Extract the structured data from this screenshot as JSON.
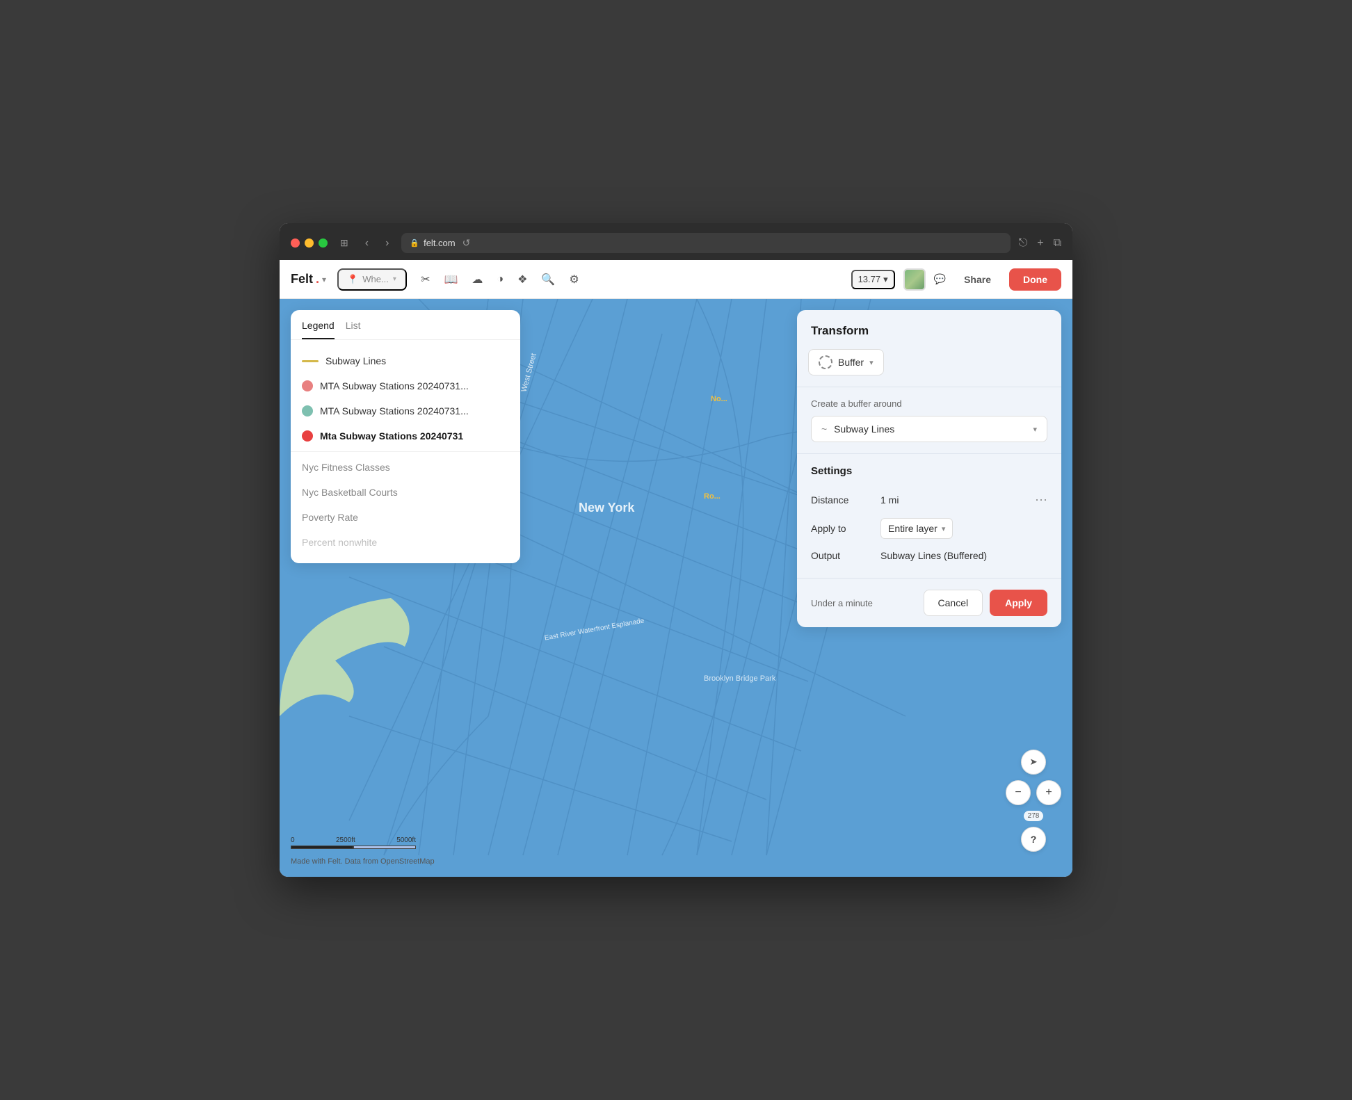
{
  "browser": {
    "url": "felt.com",
    "tab_title": "felt.com"
  },
  "toolbar": {
    "logo": "Felt",
    "search_placeholder": "Whe...",
    "zoom_level": "13.77",
    "share_label": "Share",
    "done_label": "Done"
  },
  "legend": {
    "tab_legend": "Legend",
    "tab_list": "List",
    "items": [
      {
        "type": "line",
        "color": "#d4b84a",
        "label": "Subway Lines"
      },
      {
        "type": "circle",
        "color": "#e88080",
        "label": "MTA Subway Stations 20240731..."
      },
      {
        "type": "circle",
        "color": "#7ec0b0",
        "label": "MTA Subway Stations 20240731..."
      },
      {
        "type": "circle",
        "color": "#e84040",
        "label": "Mta Subway Stations 20240731",
        "bold": true
      },
      {
        "type": "text",
        "label": "Nyc Fitness Classes"
      },
      {
        "type": "text",
        "label": "Nyc Basketball Courts"
      },
      {
        "type": "text",
        "label": "Poverty Rate"
      },
      {
        "type": "text",
        "label": "Percent nonwhite"
      }
    ]
  },
  "transform": {
    "title": "Transform",
    "type_label": "Buffer",
    "create_label": "Create a buffer around",
    "layer_label": "Subway Lines",
    "settings_title": "Settings",
    "distance_label": "Distance",
    "distance_value": "1 mi",
    "apply_to_label": "Apply to",
    "apply_to_value": "Entire layer",
    "output_label": "Output",
    "output_value": "Subway Lines (Buffered)",
    "time_estimate": "Under a minute",
    "cancel_label": "Cancel",
    "apply_label": "Apply"
  },
  "map": {
    "new_york_label": "New York",
    "street_label": "West Street",
    "esplanade_label": "East River Waterfront Esplanade",
    "brooklyn_label": "Brooklyn Bridge Park",
    "north_label": "No...",
    "ro_label": "Ro...",
    "scale_0": "0",
    "scale_2500": "2500ft",
    "scale_5000": "5000ft",
    "attribution": "Made with Felt. Data from OpenStreetMap",
    "elevation": "278"
  }
}
